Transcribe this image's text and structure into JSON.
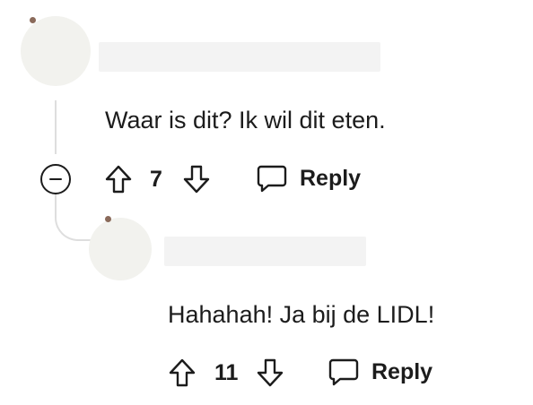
{
  "comments": [
    {
      "text": "Waar is dit? Ik wil dit eten.",
      "votes": "7",
      "reply_label": "Reply"
    },
    {
      "text": "Hahahah! Ja bij de LIDL!",
      "votes": "11",
      "reply_label": "Reply"
    }
  ],
  "icons": {
    "collapse": "collapse-minus-icon",
    "upvote": "arrow-up-icon",
    "downvote": "arrow-down-icon",
    "reply": "speech-bubble-icon"
  },
  "colors": {
    "text": "#1c1c1c",
    "thread_line": "#dedede",
    "avatar_bg": "#f2f2ee",
    "name_placeholder": "#f3f3f3"
  }
}
